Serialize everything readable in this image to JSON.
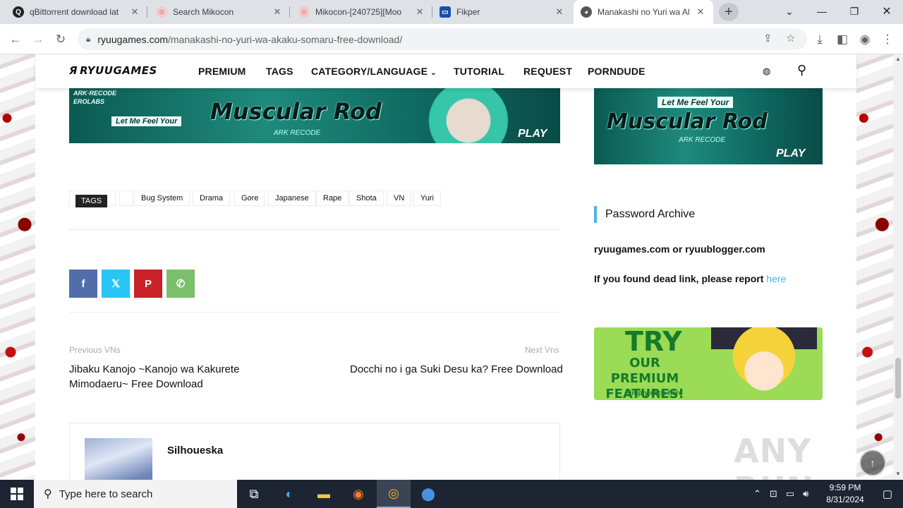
{
  "browser": {
    "tabs": [
      {
        "title": "qBittorrent download lat",
        "favicon": "q-icon",
        "active": false
      },
      {
        "title": "Search Mikocon",
        "favicon": "mikocon-icon",
        "active": false
      },
      {
        "title": "Mikocon-[240725][Moo",
        "favicon": "mikocon-icon",
        "active": false
      },
      {
        "title": "Fikper",
        "favicon": "fikper-icon",
        "active": false
      },
      {
        "title": "Manakashi no Yuri wa Al",
        "favicon": "ryuu-icon",
        "active": true
      }
    ],
    "url_domain": "ryuugames.com",
    "url_path": "/manakashi-no-yuri-wa-akaku-somaru-free-download/"
  },
  "site": {
    "logo": "RYUUGAMES",
    "nav": [
      "PREMIUM",
      "TAGS",
      "CATEGORY/LANGUAGE",
      "TUTORIAL",
      "REQUEST",
      "PORNDUDE"
    ]
  },
  "banner": {
    "brand": "ARK·RECODE",
    "brand2": "EROLABS",
    "tagline": "Let Me Feel Your",
    "title": "Muscular Rod",
    "sub": "ARK RECODE",
    "play": "PLAY"
  },
  "tags": {
    "label": "TAGS",
    "items": [
      "Bug System",
      "Drama",
      "Gore",
      "Japanese",
      "Rape",
      "Shota",
      "VN",
      "Yuri"
    ]
  },
  "share": [
    {
      "name": "facebook",
      "glyph": "f",
      "color": "#516eab"
    },
    {
      "name": "twitter-x",
      "glyph": "𝕏",
      "color": "#29c5f6"
    },
    {
      "name": "pinterest",
      "glyph": "P",
      "color": "#ca212a"
    },
    {
      "name": "whatsapp",
      "glyph": "✆",
      "color": "#7bbf6a"
    }
  ],
  "post_nav": {
    "prev_label": "Previous VNs",
    "prev_title_line1": "Jibaku Kanojo ~Kanojo wa Kakurete",
    "prev_title_line2": "Mimodaeru~ Free Download",
    "next_label": "Next Vns",
    "next_title": "Docchi no i ga Suki Desu ka? Free Download"
  },
  "author": {
    "name": "Silhoueska"
  },
  "sidebar": {
    "password_title": "Password Archive",
    "password_text": "ryuugames.com or ryuublogger.com",
    "dead_link_text": "If you found dead link, please report",
    "dead_link_anchor": "here",
    "premium_line1": "TRY",
    "premium_line2": "OUR PREMIUM FEATURES!",
    "premium_line3": "Simply click here"
  },
  "watermark": "ANY RUN",
  "taskbar": {
    "search_placeholder": "Type here to search",
    "time": "9:59 PM",
    "date": "8/31/2024"
  }
}
